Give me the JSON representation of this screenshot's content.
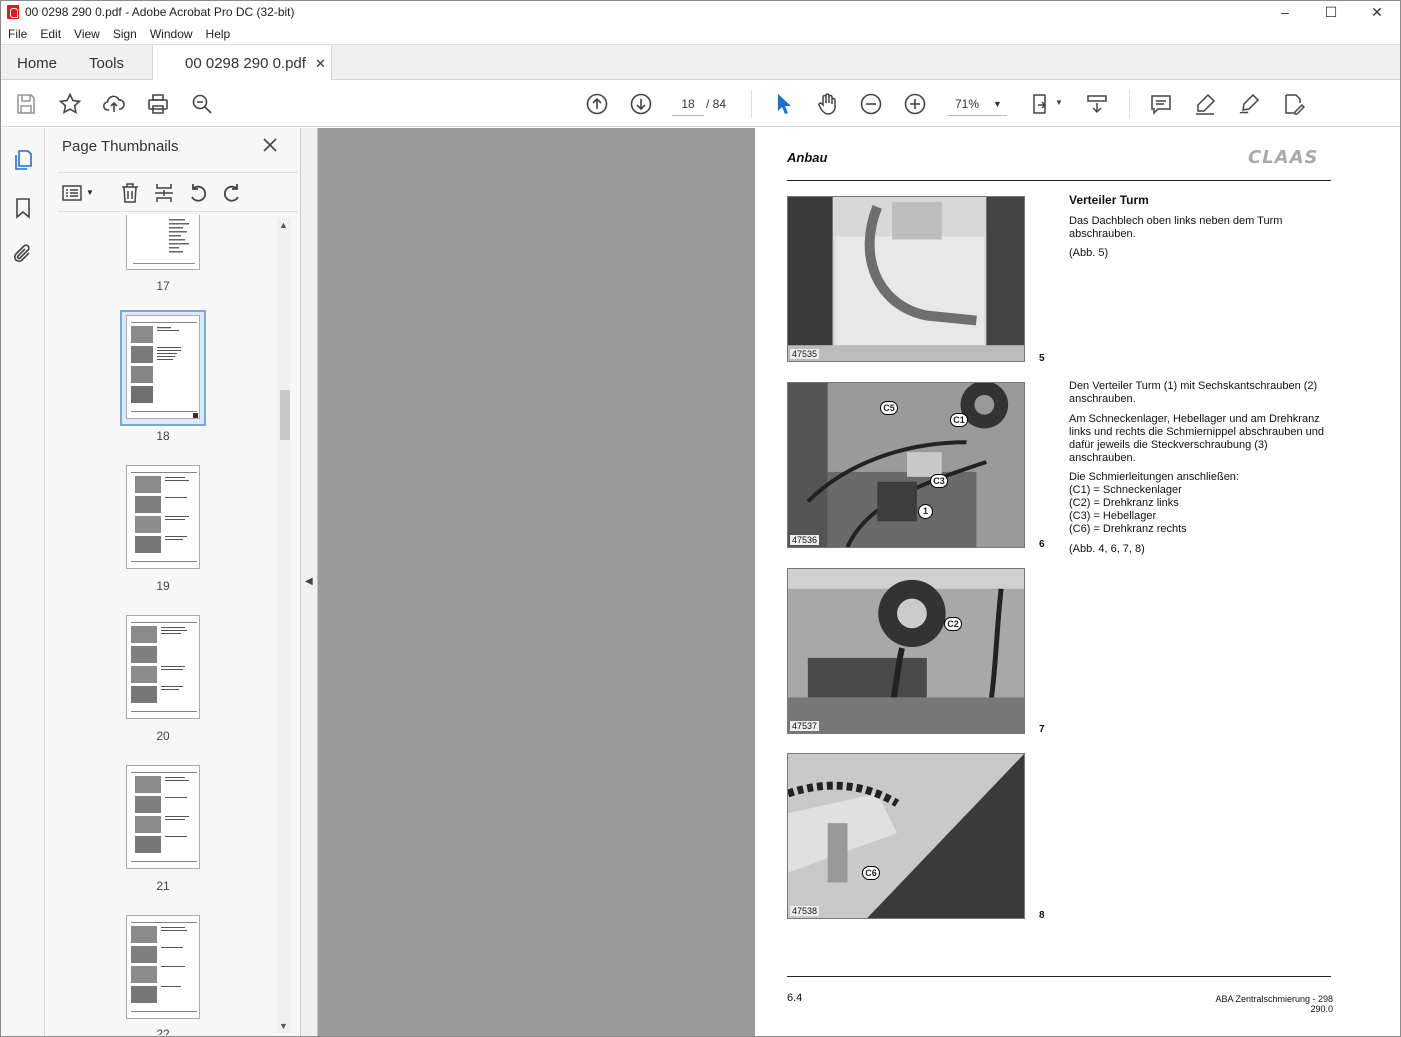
{
  "window": {
    "title": "00 0298 290 0.pdf - Adobe Acrobat Pro DC (32-bit)"
  },
  "menu": [
    "File",
    "Edit",
    "View",
    "Sign",
    "Window",
    "Help"
  ],
  "tabs": {
    "home": "Home",
    "tools": "Tools",
    "document": "00 0298 290 0.pdf"
  },
  "toolbar": {
    "page_current": "18",
    "page_total": "/ 84",
    "zoom": "71%"
  },
  "panel": {
    "title": "Page Thumbnails",
    "thumbnails": [
      "17",
      "18",
      "19",
      "20",
      "21",
      "22"
    ],
    "selected": "18"
  },
  "document": {
    "header": "Anbau",
    "logo": "CLAAS",
    "section_title": "Verteiler Turm",
    "para1": "Das Dachblech oben links neben dem Turm abschrauben.",
    "ref1": "(Abb. 5)",
    "para2": "Den Verteiler Turm (1) mit Sechskantschrauben (2) anschrauben.",
    "para3": "Am Schneckenlager, Hebellager und am Drehkranz links und rechts die Schmiernippel abschrauben und dafür jeweils die Steckverschraubung (3) anschrauben.",
    "para4": "Die Schmierleitungen anschließen:",
    "list": [
      "(C1) = Schneckenlager",
      "(C2) = Drehkranz links",
      "(C3) = Hebellager",
      "(C6) = Drehkranz rechts"
    ],
    "ref2": "(Abb. 4, 6, 7, 8)",
    "figures": [
      {
        "id": "47535",
        "num": "5"
      },
      {
        "id": "47536",
        "num": "6",
        "callouts": [
          "C5",
          "C1",
          "C3",
          "1"
        ]
      },
      {
        "id": "47537",
        "num": "7",
        "callouts": [
          "C2"
        ]
      },
      {
        "id": "47538",
        "num": "8",
        "callouts": [
          "C6"
        ]
      }
    ],
    "footer_page": "6.4",
    "footer_doc": "ABA Zentralschmierung - 298 290.0"
  }
}
